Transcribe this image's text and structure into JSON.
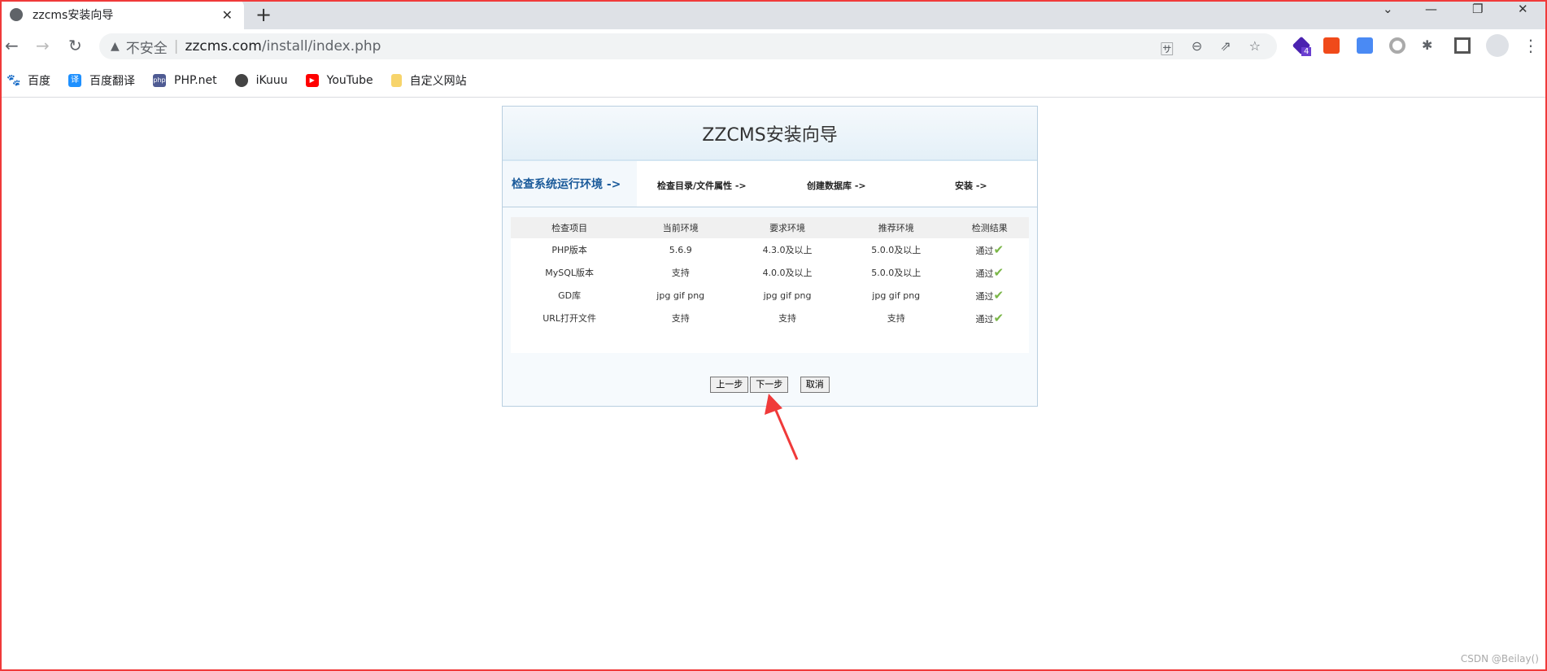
{
  "browser": {
    "tab_title": "zzcms安装向导",
    "not_secure": "不安全",
    "url_host": "zzcms.com",
    "url_path": "/install/index.php",
    "ext_badge": "4"
  },
  "bookmarks": [
    {
      "label": "百度",
      "icon": "baidu-paw-icon"
    },
    {
      "label": "百度翻译",
      "icon": "translate-icon"
    },
    {
      "label": "PHP.net",
      "icon": "php-icon"
    },
    {
      "label": "iKuuu",
      "icon": "cat-icon"
    },
    {
      "label": "YouTube",
      "icon": "youtube-icon"
    },
    {
      "label": "自定义网站",
      "icon": "folder-icon"
    }
  ],
  "installer": {
    "title": "ZZCMS安装向导",
    "steps": [
      "检查系统运行环境 ->",
      "检查目录/文件属性 ->",
      "创建数据库 ->",
      "安装 ->"
    ],
    "columns": [
      "检查项目",
      "当前环境",
      "要求环境",
      "推荐环境",
      "检测结果"
    ],
    "rows": [
      [
        "PHP版本",
        "5.6.9",
        "4.3.0及以上",
        "5.0.0及以上",
        "通过"
      ],
      [
        "MySQL版本",
        "支持",
        "4.0.0及以上",
        "5.0.0及以上",
        "通过"
      ],
      [
        "GD库",
        "jpg gif png",
        "jpg gif png",
        "jpg gif png",
        "通过"
      ],
      [
        "URL打开文件",
        "支持",
        "支持",
        "支持",
        "通过"
      ]
    ],
    "buttons": {
      "prev": "上一步",
      "next": "下一步",
      "cancel": "取消"
    }
  },
  "watermark": "CSDN @Beilay()",
  "colors": {
    "accent": "#1a5a9a",
    "pass": "#7ab648",
    "annotation": "#f03a3a"
  }
}
